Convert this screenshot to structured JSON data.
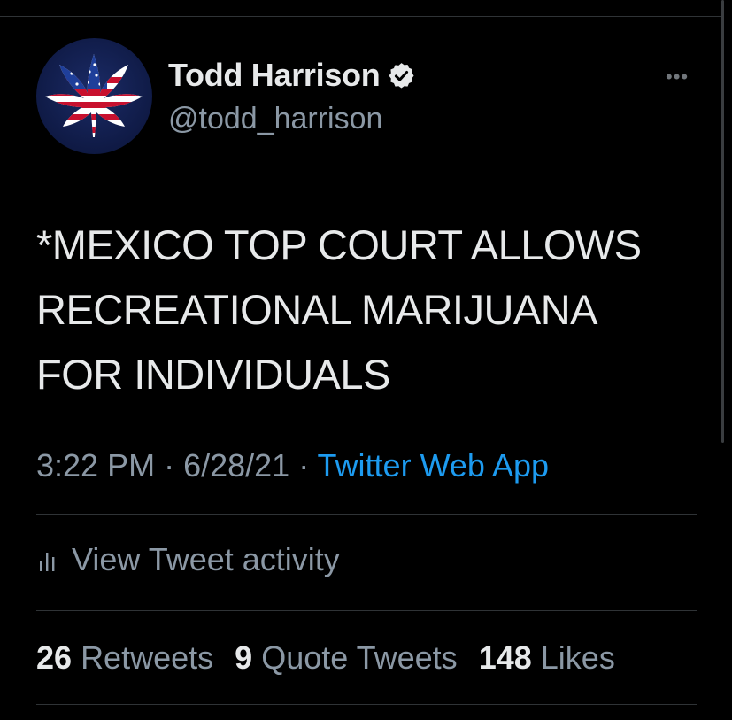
{
  "user": {
    "display_name": "Todd Harrison",
    "handle": "@todd_harrison",
    "avatar_icon": "us-flag-leaf-icon",
    "verified_icon": "verified-badge-icon"
  },
  "more_label": "•••",
  "tweet": {
    "lines": [
      "*MEXICO TOP COURT ALLOWS",
      "RECREATIONAL MARIJUANA",
      "FOR INDIVIDUALS"
    ]
  },
  "meta": {
    "time": "3:22 PM",
    "separator": " · ",
    "date": "6/28/21",
    "source": "Twitter Web App"
  },
  "activity": {
    "label": "View Tweet activity",
    "icon": "bar-chart-icon"
  },
  "stats": {
    "retweets_count": "26",
    "retweets_label": "Retweets",
    "quotes_count": "9",
    "quotes_label": "Quote Tweets",
    "likes_count": "148",
    "likes_label": "Likes"
  },
  "colors": {
    "background": "#000000",
    "primary_text": "#e7e9ea",
    "secondary_text": "#8b98a5",
    "link": "#1d9bf0",
    "divider": "#2f3336"
  }
}
